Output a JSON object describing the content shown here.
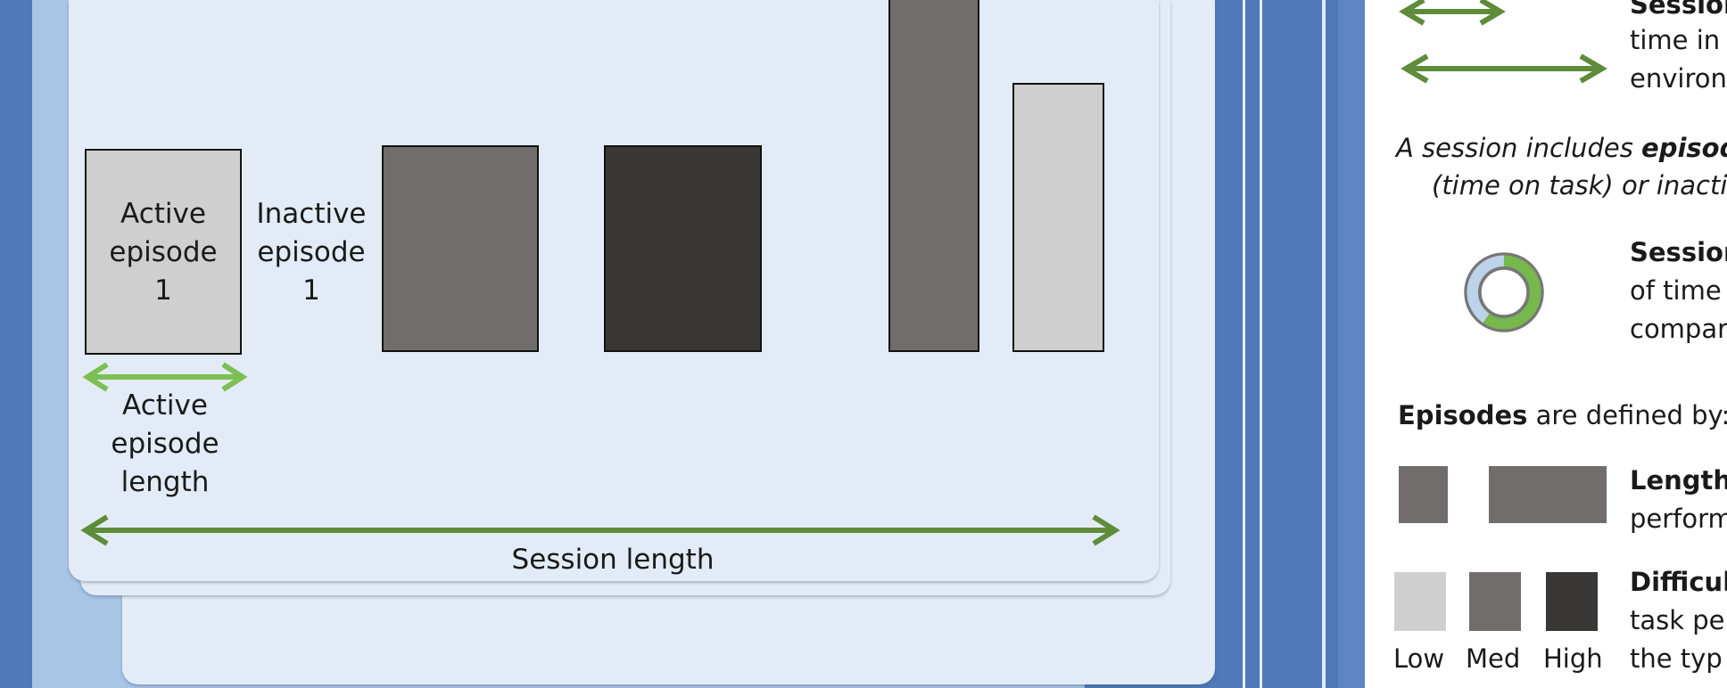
{
  "left_panel": {
    "active_episode_box": [
      "Active",
      "episode",
      "1"
    ],
    "inactive_episode_label": [
      "Inactive",
      "episode",
      "1"
    ],
    "active_episode_length_label": [
      "Active",
      "episode",
      "length"
    ],
    "session_length_label": "Session length"
  },
  "right_panel": {
    "session_row": {
      "title_partial": "Session",
      "line2_partial": "time in",
      "line3_partial": "environ"
    },
    "session_includes": {
      "line1_prefix": "A session includes ",
      "line1_bold": "episod",
      "line2": "(time on task) or inacti"
    },
    "session_ratio": {
      "title_partial": "Session",
      "line2_partial": "of time",
      "line3_partial": "compar"
    },
    "episodes_defined": {
      "bold": "Episodes",
      "rest": " are defined by:"
    },
    "length_row": {
      "title_partial": "Length,",
      "line2_partial": "perform"
    },
    "difficulty_row": {
      "title_partial": "Difficul",
      "line2_partial": "task per",
      "line3_partial": "the typ",
      "swatch_labels": [
        "Low",
        "Med",
        "High"
      ]
    }
  },
  "colors": {
    "background_blue": "#4f79b8",
    "panel": "#e3ecf6",
    "light_grey": "#d0cfd0",
    "medium_grey": "#716d6c",
    "dark_grey": "#383736",
    "dark_green": "#5e8c3a",
    "light_green": "#7cbf54"
  }
}
